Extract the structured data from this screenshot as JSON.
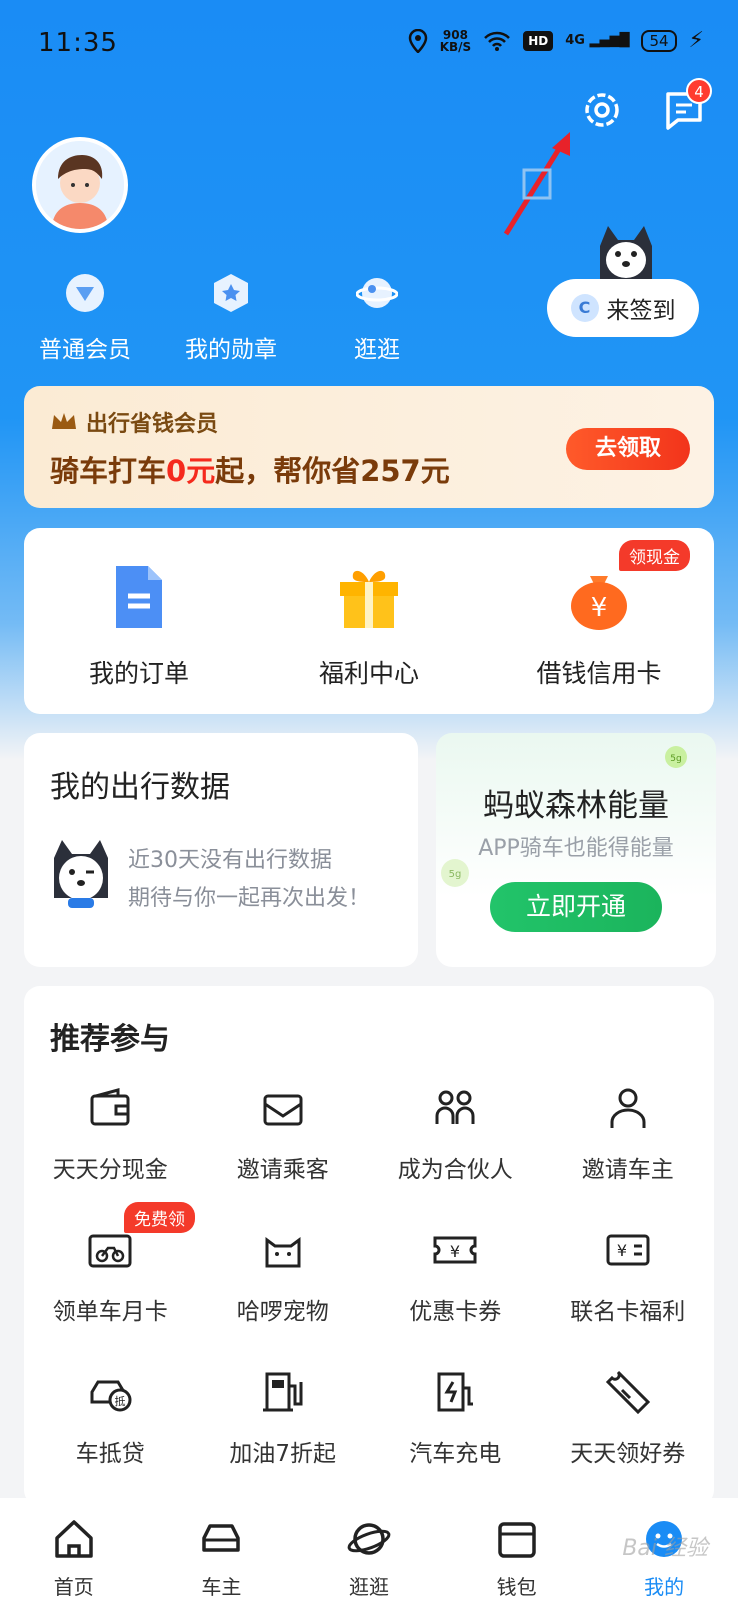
{
  "status_bar": {
    "time": "11:35",
    "speed_value": "908",
    "speed_unit": "KB/S",
    "hd": "HD",
    "signal": "4G",
    "battery": "54"
  },
  "header": {
    "message_badge": "4"
  },
  "member": {
    "items": [
      {
        "label": "普通会员",
        "icon": "vip-icon"
      },
      {
        "label": "我的勋章",
        "icon": "medal-icon"
      },
      {
        "label": "逛逛",
        "icon": "planet-icon"
      }
    ]
  },
  "signin": {
    "icon_letter": "C",
    "label": "来签到"
  },
  "promo": {
    "subtitle": "出行省钱会员",
    "title_prefix": "骑车打车",
    "title_highlight": "0元",
    "title_suffix": "起，帮你省257元",
    "button": "去领取"
  },
  "quick": {
    "items": [
      {
        "label": "我的订单",
        "icon": "order-icon"
      },
      {
        "label": "福利中心",
        "icon": "gift-icon"
      },
      {
        "label": "借钱信用卡",
        "icon": "money-bag-icon",
        "tag": "领现金"
      }
    ]
  },
  "travel": {
    "title": "我的出行数据",
    "line1": "近30天没有出行数据",
    "line2": "期待与你一起再次出发！"
  },
  "forest": {
    "title": "蚂蚁森林能量",
    "subtitle": "APP骑车也能得能量",
    "button": "立即开通"
  },
  "recommend": {
    "title": "推荐参与",
    "items": [
      {
        "label": "天天分现金",
        "icon": "wallet-icon"
      },
      {
        "label": "邀请乘客",
        "icon": "envelope-icon"
      },
      {
        "label": "成为合伙人",
        "icon": "partners-icon"
      },
      {
        "label": "邀请车主",
        "icon": "driver-icon"
      },
      {
        "label": "领单车月卡",
        "icon": "bike-card-icon",
        "tag": "免费领"
      },
      {
        "label": "哈啰宠物",
        "icon": "cat-icon"
      },
      {
        "label": "优惠卡券",
        "icon": "coupon-icon"
      },
      {
        "label": "联名卡福利",
        "icon": "cobrand-card-icon"
      },
      {
        "label": "车抵贷",
        "icon": "car-loan-icon"
      },
      {
        "label": "加油7折起",
        "icon": "fuel-icon"
      },
      {
        "label": "汽车充电",
        "icon": "charging-icon"
      },
      {
        "label": "天天领好券",
        "icon": "ticket-icon"
      }
    ]
  },
  "tabbar": {
    "items": [
      {
        "label": "首页"
      },
      {
        "label": "车主"
      },
      {
        "label": "逛逛"
      },
      {
        "label": "钱包"
      },
      {
        "label": "我的"
      }
    ]
  },
  "colors": {
    "primary": "#1a8cf5",
    "accent_red": "#f52a1d",
    "green": "#22c46a"
  },
  "watermark": "Bai 经验"
}
